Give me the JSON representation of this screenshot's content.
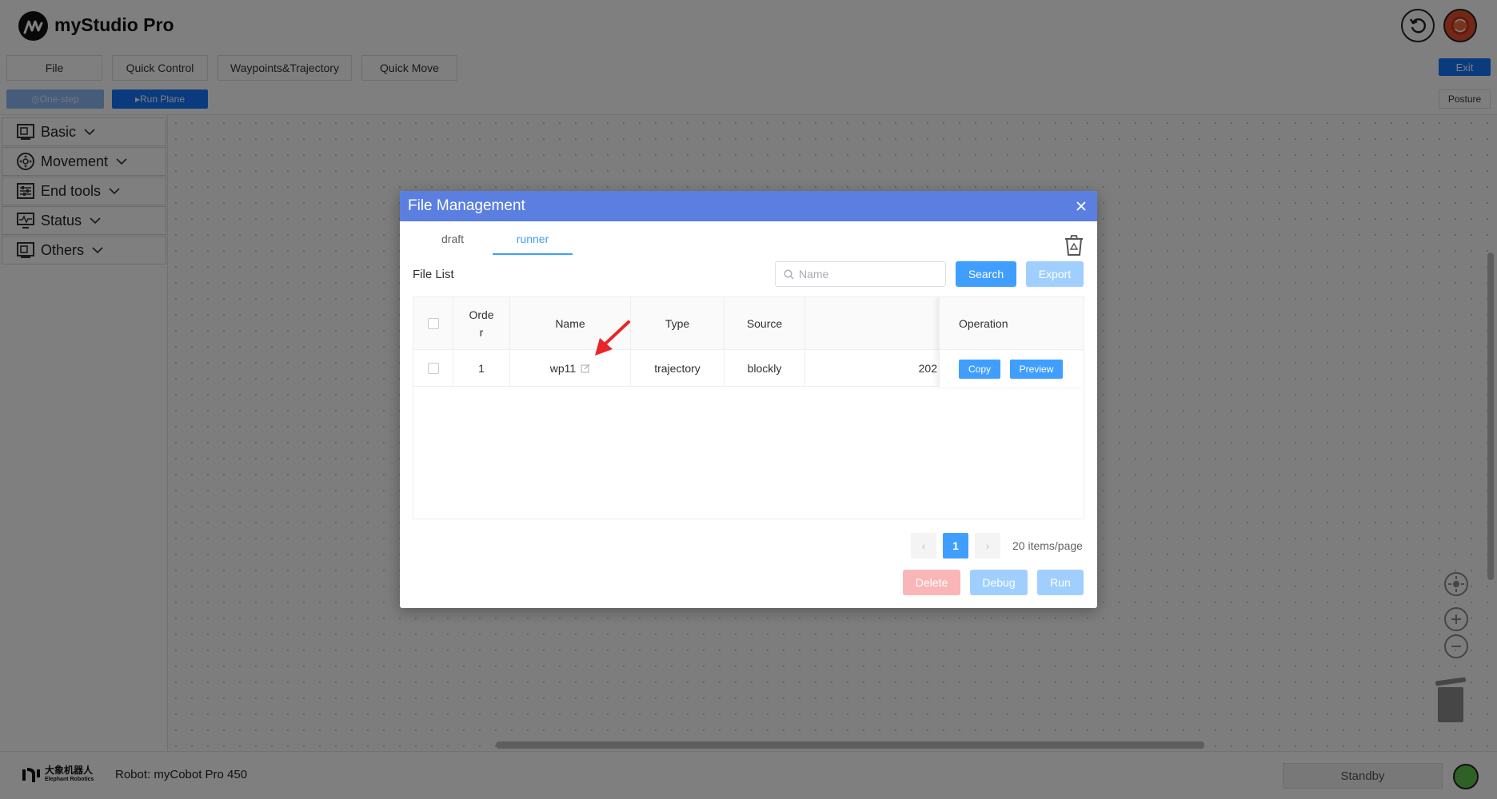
{
  "app": {
    "title": "myStudio Pro"
  },
  "menu": {
    "tabs": [
      {
        "label": "File"
      },
      {
        "label": "Quick Control"
      },
      {
        "label": "Waypoints&Trajectory"
      },
      {
        "label": "Quick Move"
      }
    ],
    "exit_label": "Exit"
  },
  "toolbar": {
    "one_step_label": "◎One-step",
    "run_plane_label": "▸Run Plane",
    "posture_label": "Posture"
  },
  "sidebar": {
    "items": [
      {
        "label": "Basic",
        "icon": "board-icon"
      },
      {
        "label": "Movement",
        "icon": "move-icon"
      },
      {
        "label": "End tools",
        "icon": "sliders-icon"
      },
      {
        "label": "Status",
        "icon": "monitor-icon"
      },
      {
        "label": "Others",
        "icon": "board-icon"
      }
    ]
  },
  "footer": {
    "brand_cn": "大象机器人",
    "brand_en": "Elephant Robotics",
    "robot_label": "Robot: myCobot Pro 450",
    "status_label": "Standby",
    "status_color": "#5fc04a"
  },
  "modal": {
    "title": "File Management",
    "tabs": {
      "draft": "draft",
      "runner": "runner",
      "active": "runner"
    },
    "file_list_title": "File List",
    "search": {
      "placeholder": "Name",
      "value": ""
    },
    "search_label": "Search",
    "export_label": "Export",
    "table": {
      "headers": {
        "order_line1": "Orde",
        "order_line2": "r",
        "name": "Name",
        "type": "Type",
        "source": "Source",
        "operation": "Operation"
      },
      "rows": [
        {
          "order": "1",
          "name": "wp11",
          "type": "trajectory",
          "source": "blockly",
          "date": "202"
        }
      ],
      "copy_label": "Copy",
      "preview_label": "Preview"
    },
    "pagination": {
      "prev": "‹",
      "current": "1",
      "next": "›",
      "page_size": "20 items/page"
    },
    "delete_label": "Delete",
    "debug_label": "Debug",
    "run_label": "Run"
  },
  "colors": {
    "primary": "#409eff",
    "modal_header": "#5b7fe1",
    "danger_disabled": "#fab6b6",
    "annotation_arrow": "#e8262a"
  }
}
